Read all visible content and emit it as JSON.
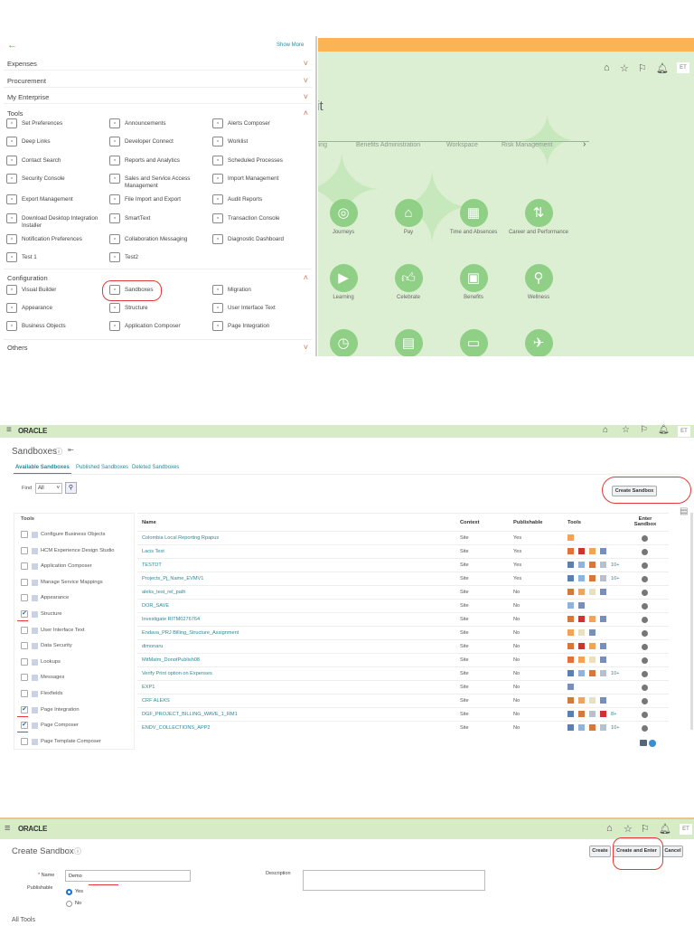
{
  "menu": {
    "show_more": "Show More",
    "sections": [
      "Expenses",
      "Procurement",
      "My Enterprise"
    ],
    "tools_heading": "Tools",
    "tools": [
      [
        "Set Preferences",
        "Announcements",
        "Alerts Composer"
      ],
      [
        "Deep Links",
        "Developer Connect",
        "Worklist"
      ],
      [
        "Contact Search",
        "Reports and Analytics",
        "Scheduled Processes"
      ],
      [
        "Security Console",
        "Sales and Service Access Management",
        "Import Management"
      ],
      [
        "Export Management",
        "File Import and Export",
        "Audit Reports"
      ],
      [
        "Download Desktop Integration Installer",
        "SmartText",
        "Transaction Console"
      ],
      [
        "Notification Preferences",
        "Collaboration Messaging",
        "Diagnostic Dashboard"
      ],
      [
        "Test 1",
        "Test2",
        ""
      ]
    ],
    "config_heading": "Configuration",
    "config": [
      [
        "Visual Builder",
        "Sandboxes",
        "Migration"
      ],
      [
        "Appearance",
        "Structure",
        "User Interface Text"
      ],
      [
        "Business Objects",
        "Application Composer",
        "Page Integration"
      ]
    ],
    "others": "Others"
  },
  "home": {
    "title_fragment": "tit",
    "tabs": [
      "illing",
      "Benefits Administration",
      "Workspace",
      "Risk Management"
    ],
    "apps": [
      [
        "Journeys",
        "Pay",
        "Time and Absences",
        "Career and Performance"
      ],
      [
        "Learning",
        "Celebrate",
        "Benefits",
        "Wellness"
      ],
      [
        "",
        "",
        "",
        ""
      ]
    ],
    "avatar": "ET"
  },
  "sandboxes": {
    "brand": "ORACLE",
    "avatar": "ET",
    "title": "Sandboxes",
    "tabs": [
      "Available Sandboxes",
      "Published Sandboxes",
      "Deleted Sandboxes"
    ],
    "find_label": "Find",
    "find_value": "All",
    "create_button": "Create Sandbox",
    "tools_heading": "Tools",
    "tools_list": [
      {
        "label": "Configure Business Objects",
        "checked": false
      },
      {
        "label": "HCM Experience Design Studio",
        "checked": false
      },
      {
        "label": "Application Composer",
        "checked": false
      },
      {
        "label": "Manage Service Mappings",
        "checked": false
      },
      {
        "label": "Appearance",
        "checked": false
      },
      {
        "label": "Structure",
        "checked": true
      },
      {
        "label": "User Interface Text",
        "checked": false
      },
      {
        "label": "Data Security",
        "checked": false
      },
      {
        "label": "Lookups",
        "checked": false
      },
      {
        "label": "Messages",
        "checked": false
      },
      {
        "label": "Flexfields",
        "checked": false
      },
      {
        "label": "Page Integration",
        "checked": true
      },
      {
        "label": "Page Composer",
        "checked": true
      },
      {
        "label": "Page Template Composer",
        "checked": false
      }
    ],
    "columns": [
      "Name",
      "Context",
      "Publishable",
      "Tools",
      "Enter Sandbox"
    ],
    "rows": [
      {
        "name": "Colombia Local Reporting Rpapus",
        "context": "Site",
        "publishable": "Yes",
        "tools": [
          "structure"
        ],
        "more": ""
      },
      {
        "name": "Lacis Test",
        "context": "Site",
        "publishable": "Yes",
        "tools": [
          "app-composer",
          "appearance",
          "structure",
          "ui-text"
        ],
        "more": ""
      },
      {
        "name": "TESTDT",
        "context": "Site",
        "publishable": "Yes",
        "tools": [
          "business-objects",
          "hcm-design",
          "app-composer",
          "service-mappings"
        ],
        "more": "10+"
      },
      {
        "name": "Projects_Pj_Name_EVMV1",
        "context": "Site",
        "publishable": "Yes",
        "tools": [
          "business-objects",
          "hcm-design",
          "app-composer",
          "service-mappings"
        ],
        "more": "10+"
      },
      {
        "name": "aleks_test_rel_path",
        "context": "Site",
        "publishable": "No",
        "tools": [
          "app-composer",
          "structure",
          "page-integration",
          "ui-text"
        ],
        "more": ""
      },
      {
        "name": "DOR_SAVE",
        "context": "Site",
        "publishable": "No",
        "tools": [
          "hcm-design",
          "ui-text"
        ],
        "more": ""
      },
      {
        "name": "Investigate RITM0276764",
        "context": "Site",
        "publishable": "No",
        "tools": [
          "app-composer",
          "appearance",
          "structure",
          "ui-text"
        ],
        "more": ""
      },
      {
        "name": "Endava_PRJ Billing_Structure_Assignment",
        "context": "Site",
        "publishable": "No",
        "tools": [
          "structure",
          "page-integration",
          "ui-text"
        ],
        "more": ""
      },
      {
        "name": "dimonaru",
        "context": "Site",
        "publishable": "No",
        "tools": [
          "app-composer",
          "appearance",
          "structure",
          "ui-text"
        ],
        "more": ""
      },
      {
        "name": "MitMatm_DonotPublish08",
        "context": "Site",
        "publishable": "No",
        "tools": [
          "app-composer",
          "structure",
          "page-integration",
          "ui-text"
        ],
        "more": ""
      },
      {
        "name": "Verify Print option on Expenses",
        "context": "Site",
        "publishable": "No",
        "tools": [
          "business-objects",
          "hcm-design",
          "app-composer",
          "service-mappings"
        ],
        "more": "10+"
      },
      {
        "name": "EXP1",
        "context": "Site",
        "publishable": "No",
        "tools": [
          "ui-text"
        ],
        "more": ""
      },
      {
        "name": "CRF ALEKS",
        "context": "Site",
        "publishable": "No",
        "tools": [
          "app-composer",
          "structure",
          "page-integration",
          "ui-text"
        ],
        "more": ""
      },
      {
        "name": "DGF_PROJECT_BILLING_WAVE_1_RM1",
        "context": "Site",
        "publishable": "No",
        "tools": [
          "business-objects",
          "app-composer",
          "service-mappings",
          "appearance"
        ],
        "more": "8+"
      },
      {
        "name": "ENDV_COLLECTIONS_APP2",
        "context": "Site",
        "publishable": "No",
        "tools": [
          "business-objects",
          "hcm-design",
          "app-composer",
          "service-mappings"
        ],
        "more": "10+"
      }
    ]
  },
  "create": {
    "brand": "ORACLE",
    "avatar": "ET",
    "title": "Create Sandbox",
    "buttons": {
      "create": "Create",
      "create_enter": "Create and Enter",
      "cancel": "Cancel"
    },
    "name_label": "Name",
    "name_value": "Demo",
    "description_label": "Description",
    "publishable_label": "Publishable",
    "yes": "Yes",
    "no": "No",
    "publishable_value": "Yes",
    "all_tools": "All Tools"
  },
  "colors": {
    "accent": "#2a8a99",
    "orange": "#e0723a",
    "header_green": "#d6ebc6",
    "annotation": "#e03a3a"
  }
}
